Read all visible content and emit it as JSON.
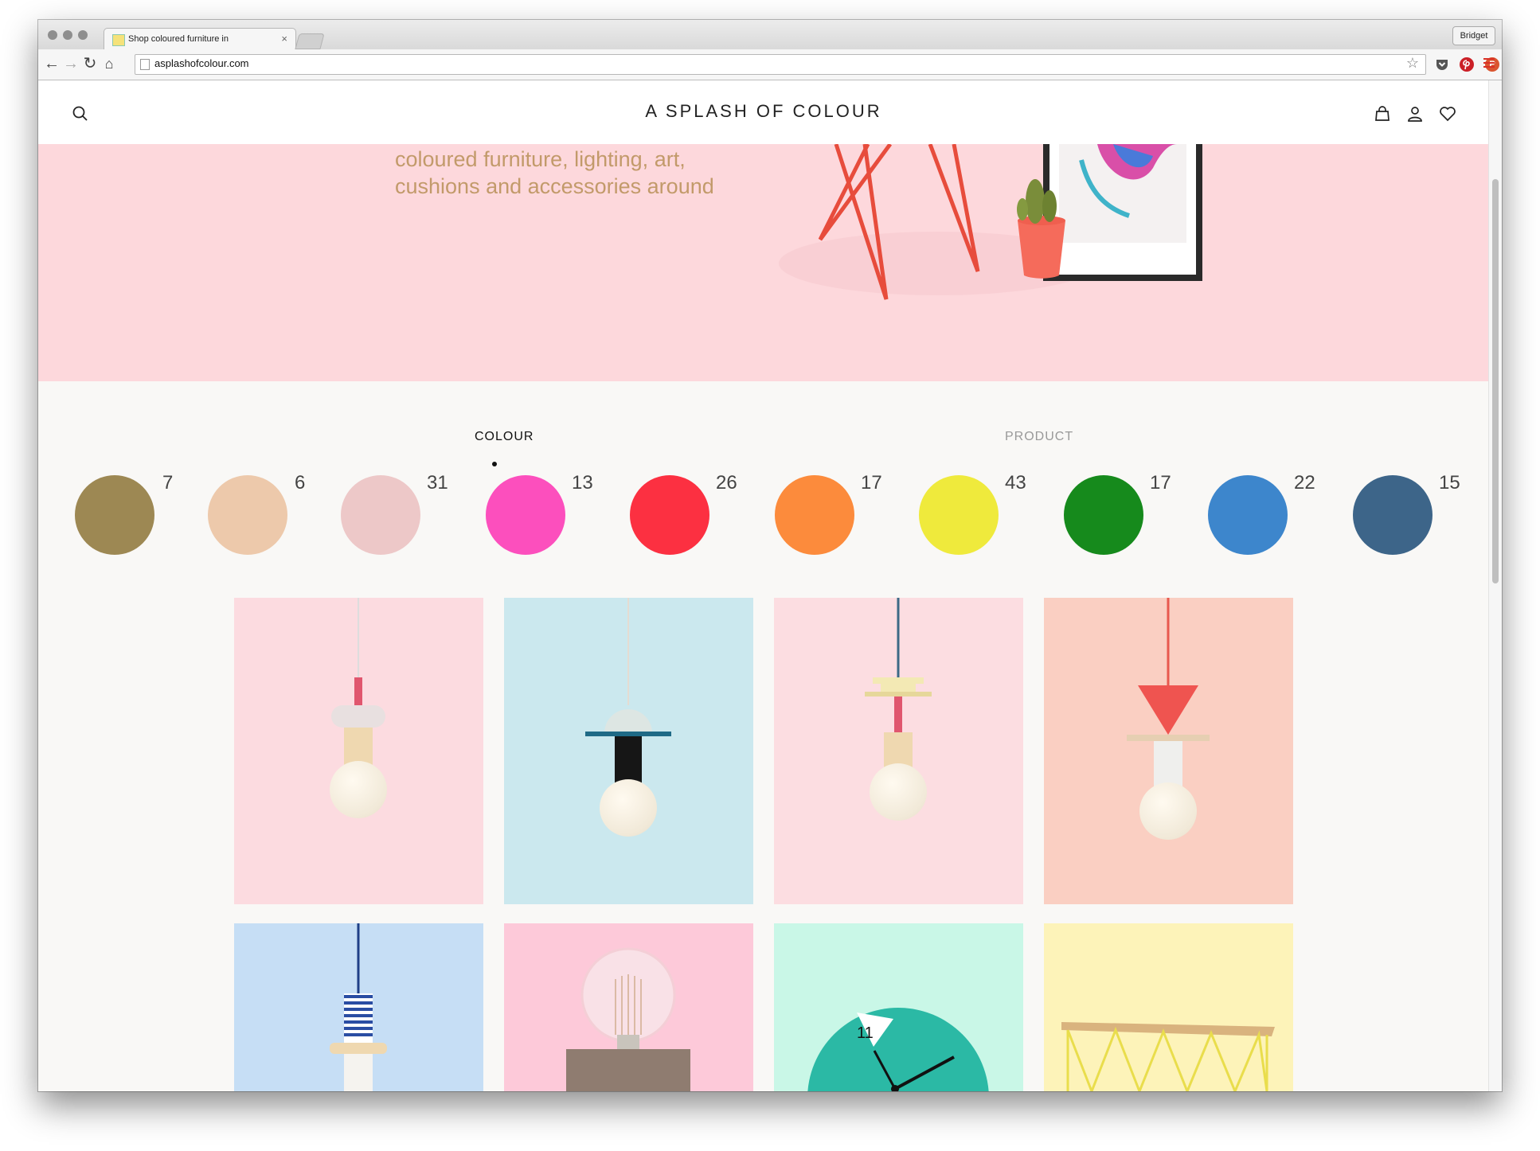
{
  "browser": {
    "tab_title": "Shop coloured furniture in",
    "tab_close": "×",
    "user_button": "Bridget",
    "url": "asplashofcolour.com",
    "extensions": [
      {
        "name": "pinterest-icon",
        "label": "",
        "color": "#cb2027"
      },
      {
        "name": "producthunt-icon",
        "label": "P",
        "color": "#da552f"
      }
    ]
  },
  "site": {
    "logo": "A SPLASH OF COLOUR",
    "hero_text_line1": "coloured furniture, lighting, art,",
    "hero_text_line2": "cushions and accessories around"
  },
  "filters": {
    "colour_label": "COLOUR",
    "product_label": "PRODUCT",
    "active": "COLOUR"
  },
  "colours": [
    {
      "name": "olive",
      "color": "#9d8853",
      "count": "7"
    },
    {
      "name": "peach",
      "color": "#edc9ab",
      "count": "6"
    },
    {
      "name": "blush",
      "color": "#edc8c8",
      "count": "31"
    },
    {
      "name": "magenta",
      "color": "#fc4fbd",
      "count": "13"
    },
    {
      "name": "red",
      "color": "#fc3041",
      "count": "26"
    },
    {
      "name": "orange",
      "color": "#fc8b3c",
      "count": "17"
    },
    {
      "name": "yellow",
      "color": "#efea3c",
      "count": "43"
    },
    {
      "name": "green",
      "color": "#168a1c",
      "count": "17"
    },
    {
      "name": "blue",
      "color": "#3d86cc",
      "count": "22"
    },
    {
      "name": "navy",
      "color": "#3d6589",
      "count": "15"
    }
  ],
  "products": [
    {
      "name": "pink-pendant-lamp",
      "bg": "#fcdbe0"
    },
    {
      "name": "teal-pendant-lamp",
      "bg": "#cbe8ee"
    },
    {
      "name": "cream-pendant-lamp",
      "bg": "#fcdde1"
    },
    {
      "name": "coral-cone-pendant-lamp",
      "bg": "#facfc2"
    },
    {
      "name": "blue-stripe-pendant-lamp",
      "bg": "#c6def5"
    },
    {
      "name": "concrete-bulb-lamp",
      "bg": "#fdc9d9"
    },
    {
      "name": "teal-wall-clock",
      "bg": "#c9f7e7",
      "clock_number": "11"
    },
    {
      "name": "yellow-console-table",
      "bg": "#fdf3b9"
    }
  ]
}
